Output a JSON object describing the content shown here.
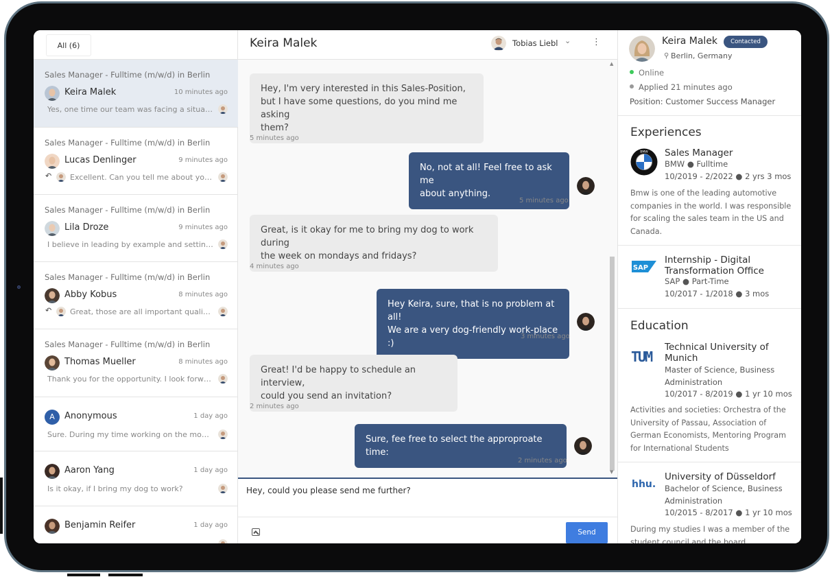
{
  "conversations_tab": "All (6)",
  "conversations": [
    {
      "job": "Sales Manager - Fulltime (m/w/d) in Berlin",
      "name": "Keira Malek",
      "time": "10 minutes ago",
      "preview": "Yes, one time our team was facing a situatio...",
      "reply": false,
      "active": true
    },
    {
      "job": "Sales Manager - Fulltime (m/w/d) in Berlin",
      "name": "Lucas Denlinger",
      "time": "9 minutes ago",
      "preview": "Excellent. Can you tell me about your l...",
      "reply": true,
      "active": false
    },
    {
      "job": "Sales Manager - Fulltime (m/w/d) in Berlin",
      "name": "Lila Droze",
      "time": "9 minutes ago",
      "preview": "I believe in leading by example and setting ...",
      "reply": false,
      "active": false
    },
    {
      "job": "Sales Manager - Fulltime (m/w/d) in Berlin",
      "name": "Abby Kobus",
      "time": "8 minutes ago",
      "preview": "Great, those are all important qualitie...",
      "reply": true,
      "active": false
    },
    {
      "job": "Sales Manager - Fulltime (m/w/d) in Berlin",
      "name": "Thomas Mueller",
      "time": "8 minutes ago",
      "preview": "Thank you for the opportunity. I look forwar...",
      "reply": false,
      "active": false
    },
    {
      "job": "",
      "name": "Anonymous",
      "initial": "A",
      "time": "1 day ago",
      "preview": "Sure. During my time working on the mobil...",
      "reply": false,
      "active": false
    },
    {
      "job": "",
      "name": "Aaron Yang",
      "time": "1 day ago",
      "preview": "Is it okay, if I bring my dog to work?",
      "reply": false,
      "active": false
    },
    {
      "job": "",
      "name": "Benjamin Reifer",
      "time": "1 day ago",
      "preview": "",
      "reply": false,
      "active": false
    }
  ],
  "chat": {
    "title": "Keira Malek",
    "agent": "Tobias Liebl",
    "messages": [
      {
        "dir": "in",
        "lines": [
          "Hey, I'm very interested in this Sales-Position,",
          "but I have some questions, do you mind me asking",
          "them?"
        ],
        "time": "5 minutes ago"
      },
      {
        "dir": "out",
        "lines": [
          "No, not at all! Feel free to ask me",
          "about anything."
        ],
        "time": "5 minutes ago"
      },
      {
        "dir": "in",
        "lines": [
          "Great, is it okay for me to bring my dog to work during",
          "the week on mondays and fridays?"
        ],
        "time": "4 minutes ago"
      },
      {
        "dir": "out",
        "lines": [
          "Hey Keira, sure, that is no problem at all!",
          "We are a very dog-friendly work-place :)"
        ],
        "time": "3 minutes ago"
      },
      {
        "dir": "in",
        "lines": [
          "Great! I'd be happy to schedule an interview,",
          "could you send an invitation?"
        ],
        "time": "2 minutes ago"
      },
      {
        "dir": "out",
        "lines": [
          "Sure, fee free to select the approproate time:"
        ],
        "time": "2 minutes ago"
      }
    ],
    "composer_text": "Hey, could you please send me further?",
    "send_label": "Send"
  },
  "profile": {
    "name": "Keira Malek",
    "badge": "Contacted",
    "location": "Berlin, Germany",
    "status": "Online",
    "applied": "Applied 21 minutes ago",
    "position": "Position: Customer Success Manager",
    "experiences_title": "Experiences",
    "experiences": [
      {
        "title_lines": [
          "Sales Manager"
        ],
        "company": "BMW",
        "type": "Fulltime",
        "dates": "10/2019 - 2/2022",
        "duration": "2 yrs 3 mos",
        "logo": "bmw-logo",
        "desc": "Bmw is one of the leading automotive companies in the world. I was responsible for scaling the sales team in the US and Canada."
      },
      {
        "title_lines": [
          "Internship - Digital",
          "Transformation Office"
        ],
        "company": "SAP",
        "type": "Part-Time",
        "dates": "10/2017 - 1/2018",
        "duration": "3 mos",
        "logo": "sap-logo",
        "desc": ""
      }
    ],
    "education_title": "Education",
    "education": [
      {
        "title_lines": [
          "Technical University of",
          "Munich"
        ],
        "degree_lines": [
          "Master of Science, Business",
          "Administration"
        ],
        "dates": "10/2017 - 8/2019",
        "duration": "1 yr 10 mos",
        "logo": "tum-logo",
        "logo_text": "TUM",
        "desc": "Activities and societies: Orchestra of the University of Passau, Association of German Economists, Mentoring Program for International Students"
      },
      {
        "title_lines": [
          "University of Düsseldorf"
        ],
        "degree_lines": [
          "Bachelor of Science, Business",
          "Administration"
        ],
        "dates": "10/2015 - 8/2017",
        "duration": "1 yr 10 mos",
        "logo": "hhu-logo",
        "logo_text": "hhu.",
        "desc": "During my studies I was a member of the student council and the board"
      }
    ]
  },
  "colors": {
    "accent": "#3a5580",
    "send": "#3f7de0",
    "active_row": "#e6ebf2",
    "online": "#3dca5b"
  }
}
